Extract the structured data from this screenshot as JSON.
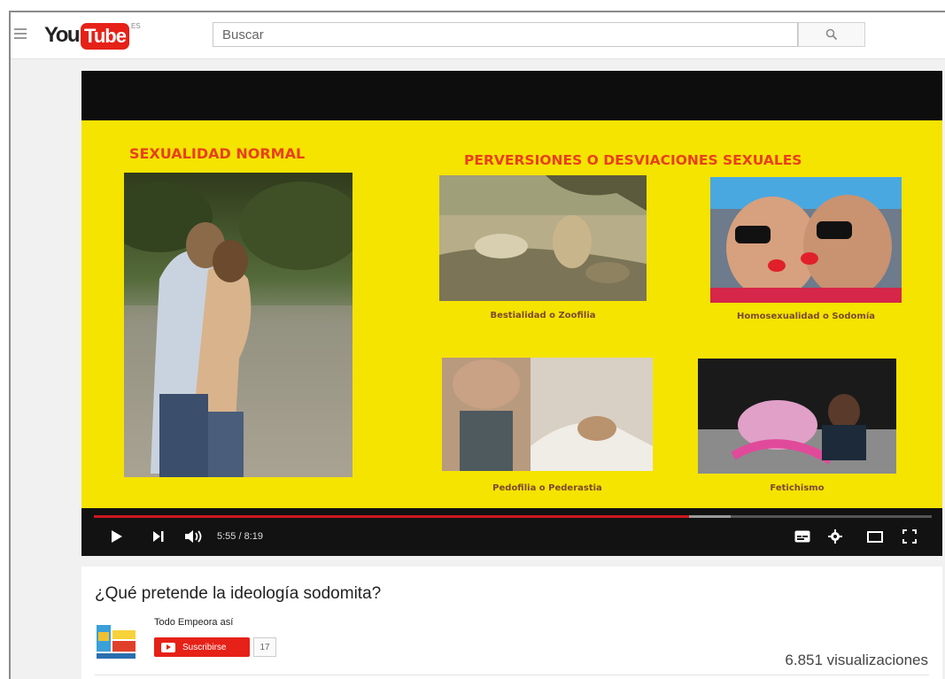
{
  "header": {
    "logo_you": "You",
    "logo_tube": "Tube",
    "logo_country": "ES",
    "search_placeholder": "Buscar"
  },
  "player": {
    "slide": {
      "left_title": "SEXUALIDAD NORMAL",
      "right_title": "PERVERSIONES O DESVIACIONES SEXUALES",
      "captions": [
        "Bestialidad o Zoofilia",
        "Homosexualidad o Sodomía",
        "Pedofilia o Pederastia",
        "Fetichismo"
      ]
    },
    "time_display": "5:55 / 8:19",
    "progress_played_fraction": 0.71,
    "progress_buffered_fraction": 0.76,
    "icons": [
      "play-icon",
      "next-icon",
      "volume-icon",
      "subtitles-icon",
      "settings-icon",
      "theater-mode-icon",
      "fullscreen-icon"
    ]
  },
  "video": {
    "title": "¿Qué pretende la ideología sodomita?",
    "channel_name": "Todo Empeora así",
    "subscribe_label": "Suscribirse",
    "subscriber_count": "17",
    "views": "6.851 visualizaciones"
  },
  "colors": {
    "youtube_red": "#e62117",
    "slide_yellow": "#f5e300",
    "slide_title_orange": "#e8401c",
    "progress_red": "#cc181e"
  }
}
